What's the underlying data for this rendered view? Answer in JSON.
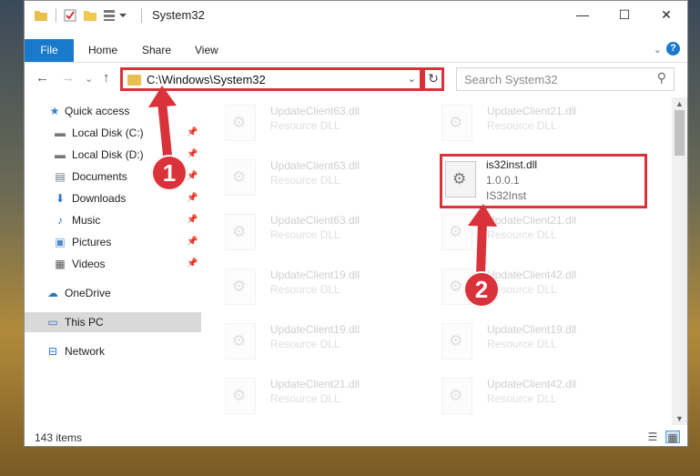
{
  "window": {
    "title": "System32",
    "controls": {
      "minimize": "—",
      "maximize": "☐",
      "close": "✕"
    }
  },
  "ribbon": {
    "tabs": [
      {
        "label": "File"
      },
      {
        "label": "Home"
      },
      {
        "label": "Share"
      },
      {
        "label": "View"
      }
    ],
    "expand_glyph": "⌄",
    "help_glyph": "?"
  },
  "navigation": {
    "back": "←",
    "forward": "→",
    "recent": "⌄",
    "up": "↑",
    "address": "C:\\Windows\\System32",
    "address_dropdown": "⌄",
    "refresh": "↻",
    "search_placeholder": "Search System32",
    "search_icon": "⚲"
  },
  "sidebar": {
    "items": [
      {
        "label": "Quick access",
        "icon": "star-icon",
        "glyph": "★",
        "pinned": false
      },
      {
        "label": "Local Disk (C:)",
        "icon": "drive-icon",
        "glyph": "▬",
        "pinned": true
      },
      {
        "label": "Local Disk (D:)",
        "icon": "drive-icon",
        "glyph": "▬",
        "pinned": true
      },
      {
        "label": "Documents",
        "icon": "documents-icon",
        "glyph": "▤",
        "pinned": true
      },
      {
        "label": "Downloads",
        "icon": "downloads-icon",
        "glyph": "⬇",
        "pinned": true
      },
      {
        "label": "Music",
        "icon": "music-icon",
        "glyph": "♪",
        "pinned": true
      },
      {
        "label": "Pictures",
        "icon": "pictures-icon",
        "glyph": "▣",
        "pinned": true
      },
      {
        "label": "Videos",
        "icon": "videos-icon",
        "glyph": "▦",
        "pinned": true
      },
      {
        "label": "OneDrive",
        "icon": "cloud-icon",
        "glyph": "☁",
        "pinned": false
      },
      {
        "label": "This PC",
        "icon": "computer-icon",
        "glyph": "▭",
        "pinned": false,
        "selected": true
      },
      {
        "label": "Network",
        "icon": "network-icon",
        "glyph": "⊟",
        "pinned": false
      }
    ],
    "pin_glyph": "📌"
  },
  "files": [
    {
      "name": "UpdateClient63.dll",
      "type": "Resource DLL",
      "faded": true
    },
    {
      "name": "UpdateClient21.dll",
      "type": "Resource DLL",
      "faded": true
    },
    {
      "name": "UpdateClient63.dll",
      "type": "Resource DLL",
      "faded": true
    },
    {
      "name": "is32inst.dll",
      "type": "1.0.0.1",
      "sub": "IS32Inst",
      "faded": false,
      "highlight": true
    },
    {
      "name": "UpdateClient63.dll",
      "type": "Resource DLL",
      "faded": true
    },
    {
      "name": "UpdateClient21.dll",
      "type": "Resource DLL",
      "faded": true
    },
    {
      "name": "UpdateClient19.dll",
      "type": "Resource DLL",
      "faded": true
    },
    {
      "name": "UpdateClient42.dll",
      "type": "Resource DLL",
      "faded": true
    },
    {
      "name": "UpdateClient19.dll",
      "type": "Resource DLL",
      "faded": true
    },
    {
      "name": "UpdateClient19.dll",
      "type": "Resource DLL",
      "faded": true
    },
    {
      "name": "UpdateClient21.dll",
      "type": "Resource DLL",
      "faded": true
    },
    {
      "name": "UpdateClient42.dll",
      "type": "Resource DLL",
      "faded": true
    }
  ],
  "status": {
    "item_count": "143 items",
    "details_view_glyph": "☰",
    "tiles_view_glyph": "▦"
  },
  "annotations": [
    {
      "number": "1"
    },
    {
      "number": "2"
    }
  ],
  "colors": {
    "accent": "#1979ca",
    "annotation": "#d9323a"
  }
}
